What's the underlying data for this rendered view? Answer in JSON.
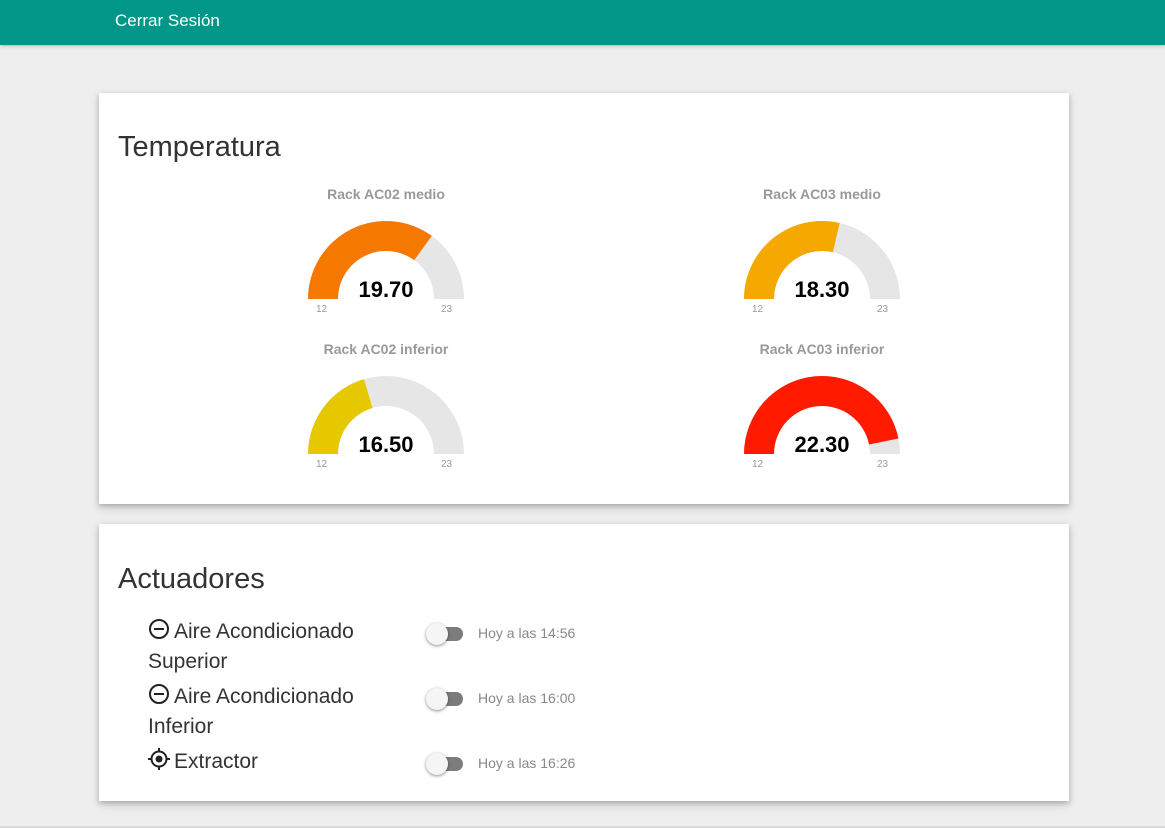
{
  "colors": {
    "brand": "#009688",
    "gauge_track": "#e6e6e6"
  },
  "header": {
    "logout_label": "Cerrar Sesión"
  },
  "temperature": {
    "title": "Temperatura",
    "gauges": [
      {
        "title": "Rack AC02 medio",
        "value": 19.7,
        "value_text": "19.70",
        "min": 12,
        "max": 23,
        "min_label": "12",
        "max_label": "23",
        "color": "#f57800"
      },
      {
        "title": "Rack AC03 medio",
        "value": 18.3,
        "value_text": "18.30",
        "min": 12,
        "max": 23,
        "min_label": "12",
        "max_label": "23",
        "color": "#f5a800"
      },
      {
        "title": "Rack AC02 inferior",
        "value": 16.5,
        "value_text": "16.50",
        "min": 12,
        "max": 23,
        "min_label": "12",
        "max_label": "23",
        "color": "#e6c800"
      },
      {
        "title": "Rack AC03 inferior",
        "value": 22.3,
        "value_text": "22.30",
        "min": 12,
        "max": 23,
        "min_label": "12",
        "max_label": "23",
        "color": "#ff1a00"
      }
    ]
  },
  "actuators": {
    "title": "Actuadores",
    "items": [
      {
        "label_line1": "Aire Acondicionado",
        "label_line2": "Superior",
        "icon": "minus-circle-icon",
        "state": "off",
        "time": "Hoy a las 14:56"
      },
      {
        "label_line1": "Aire Acondicionado",
        "label_line2": "Inferior",
        "icon": "minus-circle-icon",
        "state": "off",
        "time": "Hoy a las 16:00"
      },
      {
        "label_line1": "Extractor",
        "label_line2": "",
        "icon": "target-icon",
        "state": "off",
        "time": "Hoy a las 16:26"
      }
    ]
  }
}
